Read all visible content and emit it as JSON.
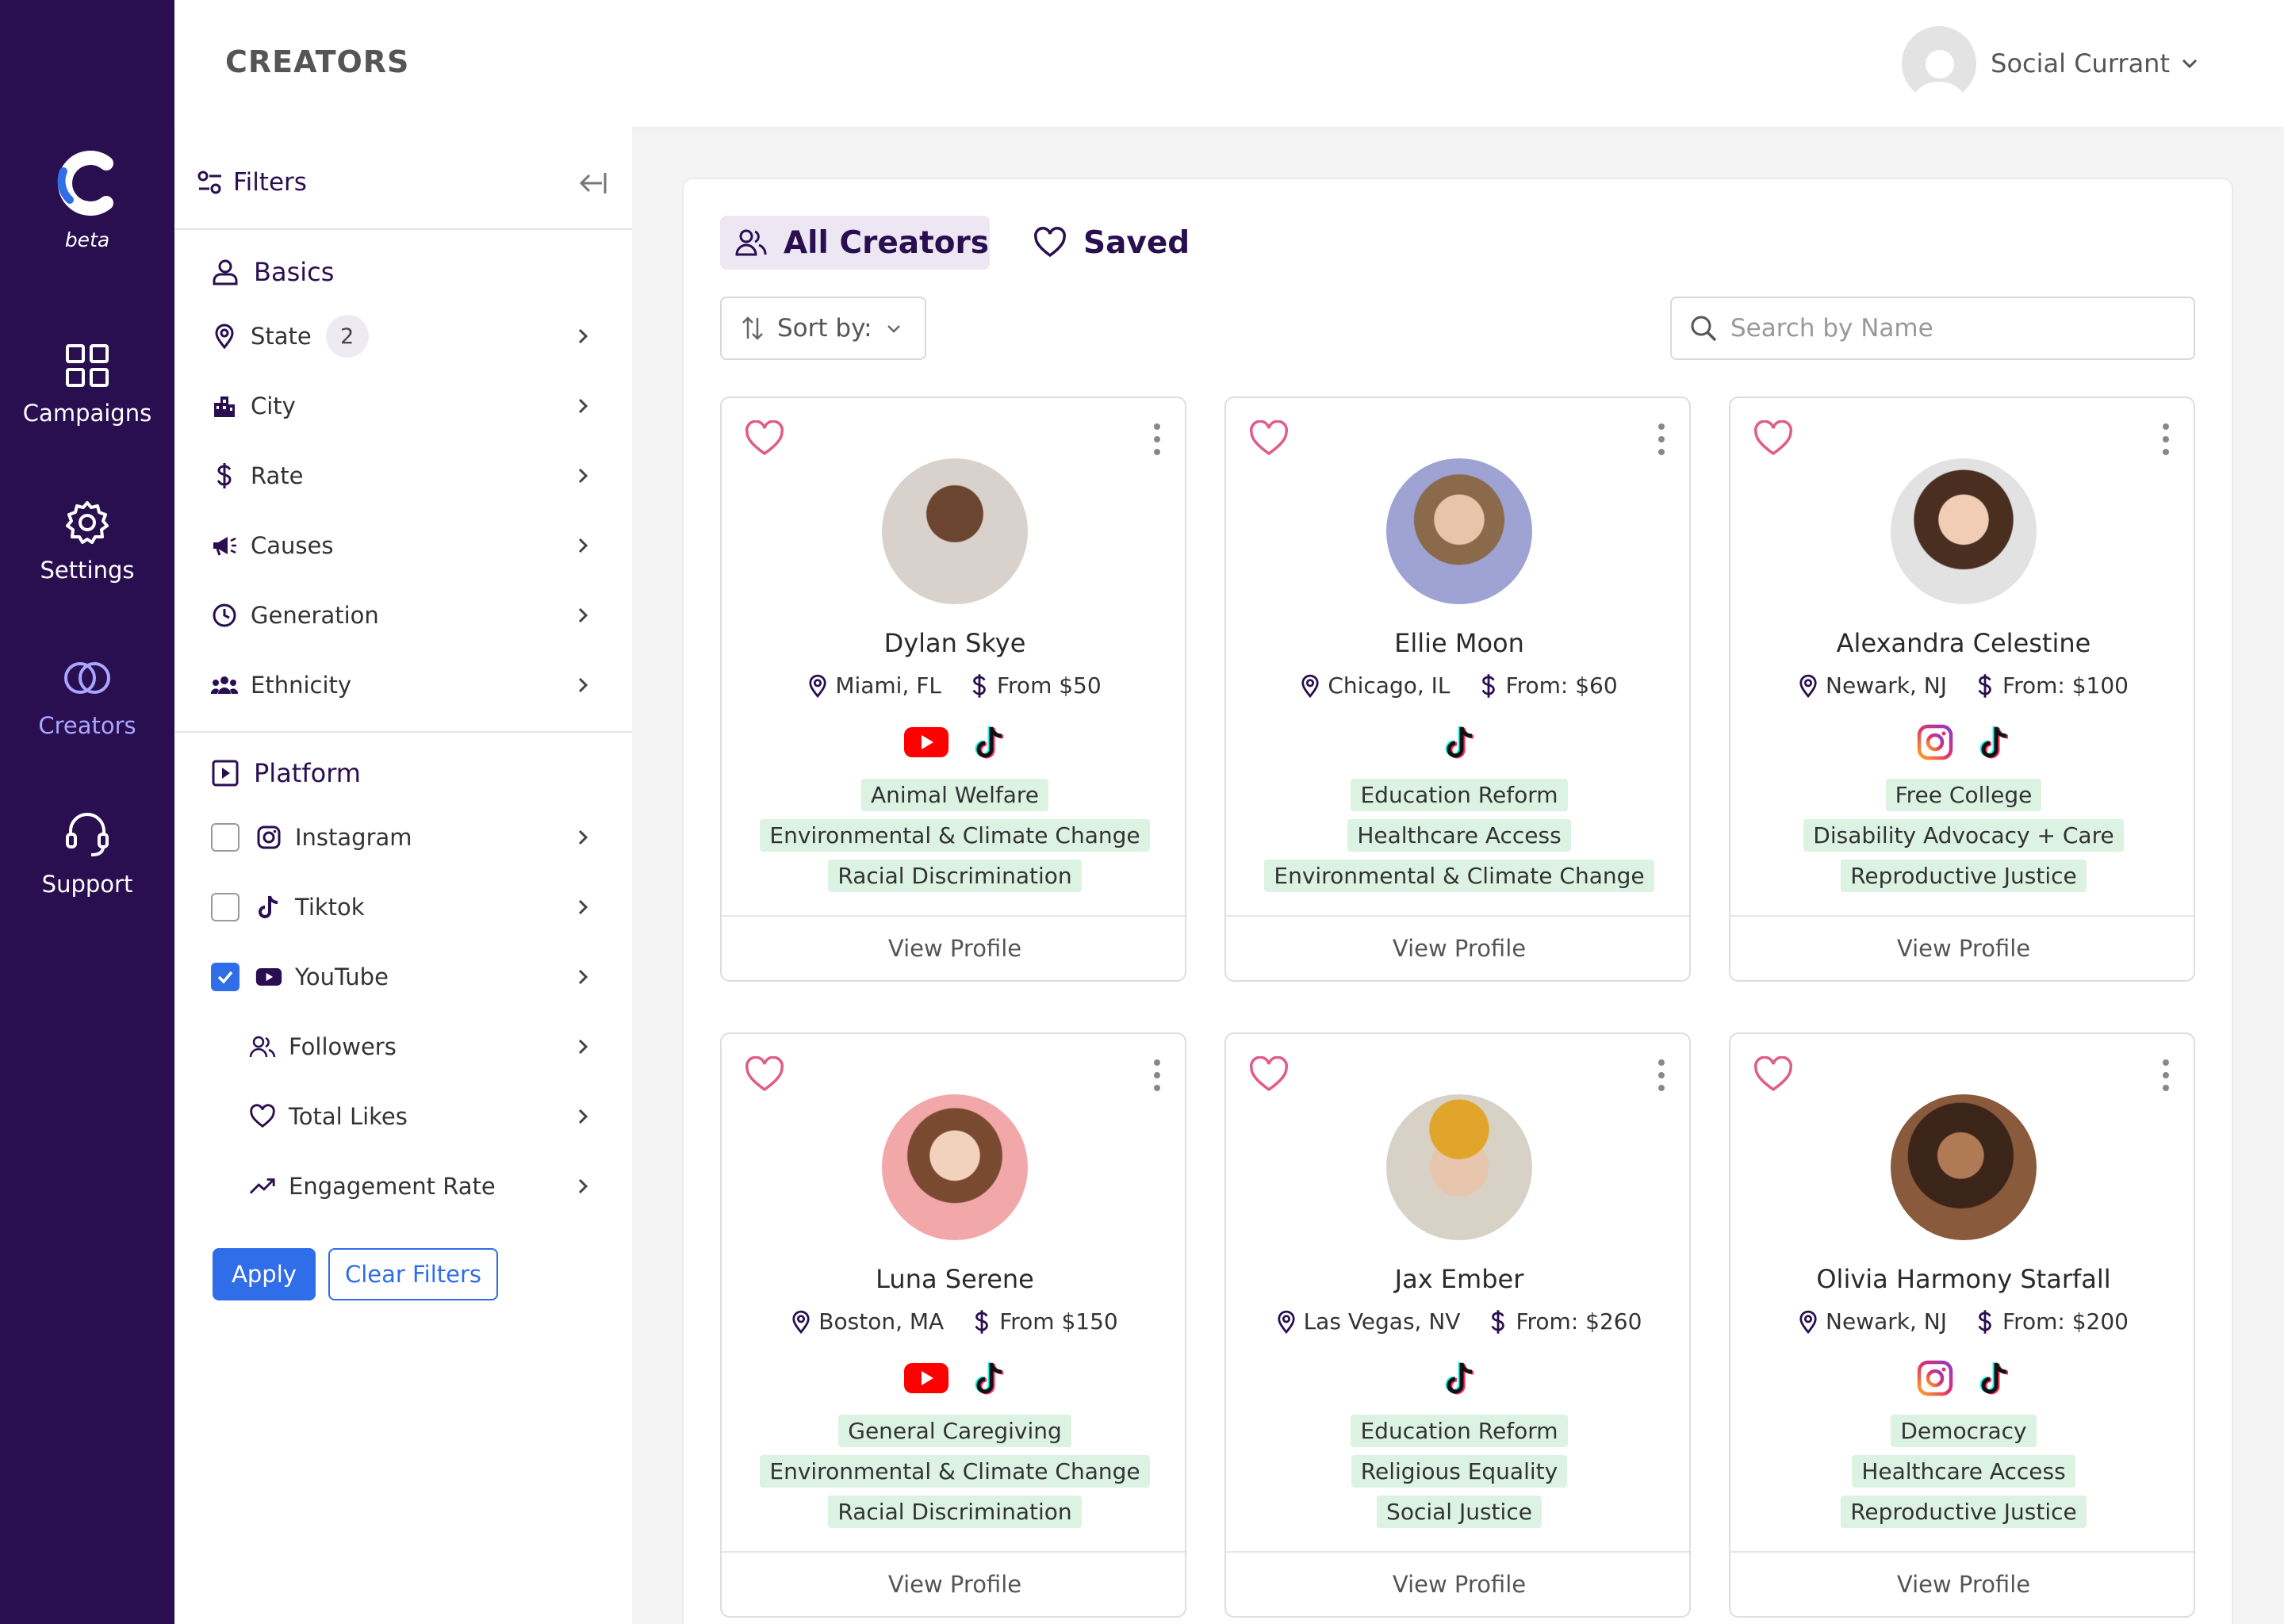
{
  "nav": {
    "beta_label": "beta",
    "items": [
      {
        "label": "Campaigns",
        "icon": "grid-icon"
      },
      {
        "label": "Settings",
        "icon": "gear-icon"
      },
      {
        "label": "Creators",
        "icon": "rings-icon",
        "active": true
      },
      {
        "label": "Support",
        "icon": "headset-icon"
      }
    ]
  },
  "header": {
    "title": "CREATORS",
    "account_name": "Social Currant"
  },
  "filters": {
    "title": "Filters",
    "basics": {
      "title": "Basics",
      "items": [
        {
          "label": "State",
          "count": "2",
          "icon": "pin-icon"
        },
        {
          "label": "City",
          "icon": "city-icon"
        },
        {
          "label": "Rate",
          "icon": "dollar-icon"
        },
        {
          "label": "Causes",
          "icon": "megaphone-icon"
        },
        {
          "label": "Generation",
          "icon": "clock-icon"
        },
        {
          "label": "Ethnicity",
          "icon": "people-icon"
        }
      ]
    },
    "platform": {
      "title": "Platform",
      "items": [
        {
          "label": "Instagram",
          "checked": false
        },
        {
          "label": "Tiktok",
          "checked": false
        },
        {
          "label": "YouTube",
          "checked": true
        }
      ],
      "sub_items": [
        {
          "label": "Followers",
          "icon": "followers-icon"
        },
        {
          "label": "Total Likes",
          "icon": "heart-icon"
        },
        {
          "label": "Engagement Rate",
          "icon": "trend-icon"
        }
      ]
    },
    "apply_label": "Apply",
    "clear_label": "Clear Filters"
  },
  "main": {
    "tabs": [
      {
        "label": "All Creators",
        "active": true
      },
      {
        "label": "Saved",
        "active": false
      }
    ],
    "sort_label": "Sort by:",
    "search_placeholder": "Search by Name",
    "view_profile_label": "View Profile",
    "creators": [
      {
        "name": "Dylan Skye",
        "location": "Miami, FL",
        "rate": "From $50",
        "platforms": [
          "youtube",
          "tiktok"
        ],
        "tags": [
          "Animal Welfare",
          "Environmental & Climate Change",
          "Racial Discrimination"
        ],
        "photo_color": "#b58a6c"
      },
      {
        "name": "Ellie Moon",
        "location": "Chicago, IL",
        "rate": "From: $60",
        "platforms": [
          "tiktok"
        ],
        "tags": [
          "Education Reform",
          "Healthcare Access",
          "Environmental & Climate Change"
        ],
        "photo_color": "#9ea3d4"
      },
      {
        "name": "Alexandra Celestine",
        "location": "Newark, NJ",
        "rate": "From: $100",
        "platforms": [
          "instagram",
          "tiktok"
        ],
        "tags": [
          "Free College",
          "Disability Advocacy + Care",
          "Reproductive Justice"
        ],
        "photo_color": "#dcdcdc"
      },
      {
        "name": "Luna Serene",
        "location": "Boston, MA",
        "rate": "From $150",
        "platforms": [
          "youtube",
          "tiktok"
        ],
        "tags": [
          "General Caregiving",
          "Environmental & Climate Change",
          "Racial Discrimination"
        ],
        "photo_color": "#f2a8a8"
      },
      {
        "name": "Jax Ember",
        "location": "Las Vegas, NV",
        "rate": "From: $260",
        "platforms": [
          "tiktok"
        ],
        "tags": [
          "Education Reform",
          "Religious Equality",
          "Social Justice"
        ],
        "photo_color": "#d8d2c6"
      },
      {
        "name": "Olivia Harmony Starfall",
        "location": "Newark, NJ",
        "rate": "From: $200",
        "platforms": [
          "instagram",
          "tiktok"
        ],
        "tags": [
          "Democracy",
          "Healthcare Access",
          "Reproductive Justice"
        ],
        "photo_color": "#8a5a3c"
      }
    ]
  },
  "colors": {
    "rail": "#2a0f50",
    "accent": "#2f6ee8",
    "active_nav": "#a9a6ff",
    "tag_bg": "#dcf2e2",
    "heart": "#e05c8a"
  }
}
